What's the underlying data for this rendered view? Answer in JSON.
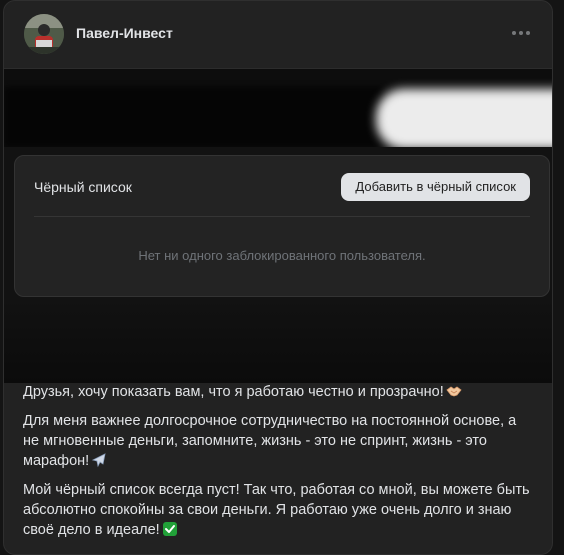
{
  "post": {
    "author_name": "Павел-Инвест",
    "more_icon": "more-horizontal-icon",
    "paragraphs": [
      "Друзья, хочу показать вам, что я работаю честно и прозрачно!",
      "Для меня важнее долгосрочное сотрудничество на постоянной основе, а не мгновенные деньги, запомните, жизнь - это не спринт, жизнь - это марафон!",
      "Мой чёрный список всегда пуст! Так что, работая со мной, вы можете быть абсолютно спокойны за свои деньги. Я работаю уже очень долго и знаю своё дело в идеале!"
    ],
    "paragraph_icons": [
      "handshake-icon",
      "airplane-icon",
      "check-mark-icon"
    ]
  },
  "blacklist": {
    "title": "Чёрный список",
    "add_button_label": "Добавить в чёрный список",
    "empty_message": "Нет ни одного заблокированного пользователя."
  },
  "colors": {
    "background": "#141414",
    "card": "#222222",
    "text": "#e1e3e6",
    "muted": "#6f7378",
    "button": "#e1e3e6",
    "check_green": "#21a038"
  }
}
